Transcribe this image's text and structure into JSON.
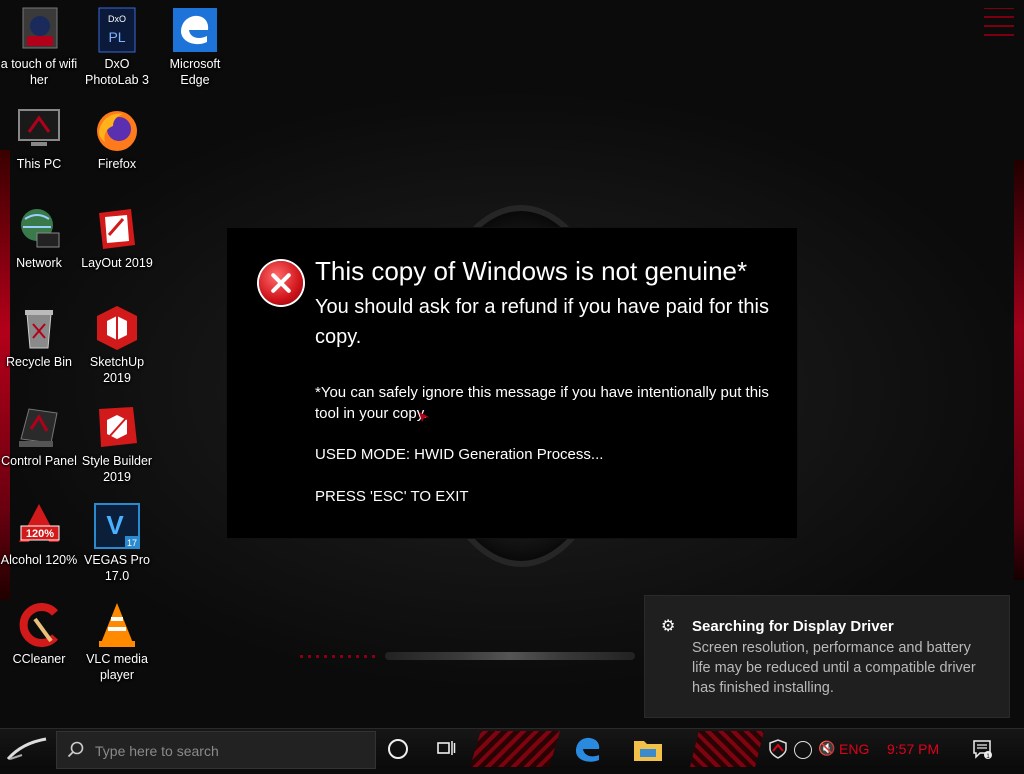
{
  "desktop": {
    "icons": [
      {
        "label": "a touch of wifi her",
        "name": "a-touch-of-wifi-her-icon"
      },
      {
        "label": "DxO PhotoLab 3",
        "name": "dxo-photolab-icon"
      },
      {
        "label": "Microsoft Edge",
        "name": "microsoft-edge-icon"
      },
      {
        "label": "This PC",
        "name": "this-pc-icon"
      },
      {
        "label": "Firefox",
        "name": "firefox-icon"
      },
      {
        "label": "Network",
        "name": "network-icon"
      },
      {
        "label": "LayOut 2019",
        "name": "layout-2019-icon"
      },
      {
        "label": "Recycle Bin",
        "name": "recycle-bin-icon"
      },
      {
        "label": "SketchUp 2019",
        "name": "sketchup-2019-icon"
      },
      {
        "label": "Control Panel",
        "name": "control-panel-icon"
      },
      {
        "label": "Style Builder 2019",
        "name": "style-builder-2019-icon"
      },
      {
        "label": "Alcohol 120%",
        "name": "alcohol-120-icon"
      },
      {
        "label": "VEGAS Pro 17.0",
        "name": "vegas-pro-icon"
      },
      {
        "label": "CCleaner",
        "name": "ccleaner-icon"
      },
      {
        "label": "VLC media player",
        "name": "vlc-icon"
      }
    ],
    "dxo_badge": "DxO",
    "dxo_sub": "PL",
    "alcohol_badge": "120%",
    "vegas_letter": "V",
    "vegas_badge": "17"
  },
  "dialog": {
    "icon": "error-icon",
    "title": "This copy of Windows is not genuine*",
    "subtitle": "You should ask for a refund if you have paid for this copy.",
    "note": "*You can safely ignore this message if you have intentionally put this tool in your copy.",
    "mode": "USED MODE: HWID Generation Process...",
    "exit": "PRESS 'ESC' TO EXIT"
  },
  "toast": {
    "icon": "gear-icon",
    "title": "Searching for Display Driver",
    "body": "Screen resolution, performance and battery life may be reduced until a compatible driver has finished installing."
  },
  "taskbar": {
    "search_placeholder": "Type here to search",
    "language": "ENG",
    "time": "9:57 PM",
    "action_center_badge": "1"
  },
  "colors": {
    "accent_red": "#e0001a",
    "dialog_bg": "#000000",
    "toast_bg": "#1f1f1f"
  }
}
